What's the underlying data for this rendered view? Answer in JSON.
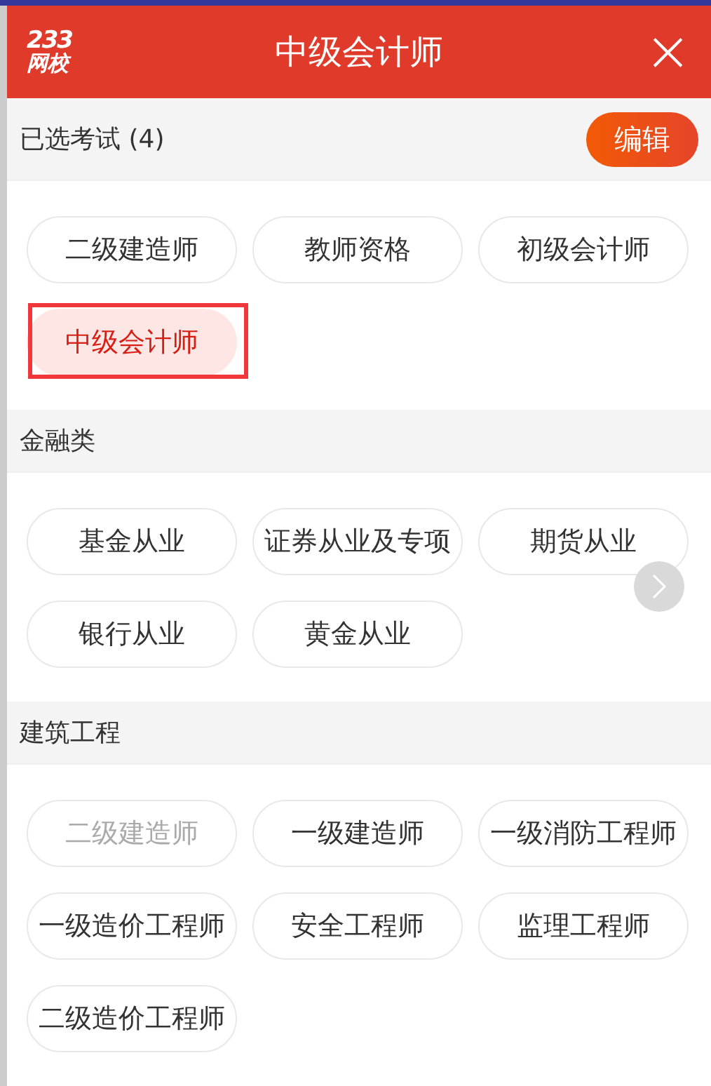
{
  "header": {
    "logo": {
      "number": "233",
      "name": "网校"
    },
    "title": "中级会计师",
    "close": "×"
  },
  "selected_exams": {
    "label": "已选考试 (4)",
    "edit_button": "编辑",
    "items": [
      {
        "label": "二级建造师",
        "selected": false,
        "outlined": false
      },
      {
        "label": "教师资格",
        "selected": false,
        "outlined": false
      },
      {
        "label": "初级会计师",
        "selected": false,
        "outlined": false
      },
      {
        "label": "中级会计师",
        "selected": true,
        "outlined": true
      }
    ]
  },
  "categories": [
    {
      "title": "金融类",
      "items": [
        {
          "label": "基金从业",
          "disabled": false
        },
        {
          "label": "证券从业及专项",
          "disabled": false
        },
        {
          "label": "期货从业",
          "disabled": false
        },
        {
          "label": "银行从业",
          "disabled": false
        },
        {
          "label": "黄金从业",
          "disabled": false
        }
      ]
    },
    {
      "title": "建筑工程",
      "items": [
        {
          "label": "二级建造师",
          "disabled": true
        },
        {
          "label": "一级建造师",
          "disabled": false
        },
        {
          "label": "一级消防工程师",
          "disabled": false
        },
        {
          "label": "一级造价工程师",
          "disabled": false
        },
        {
          "label": "安全工程师",
          "disabled": false
        },
        {
          "label": "监理工程师",
          "disabled": false
        },
        {
          "label": "二级造价工程师",
          "disabled": false
        }
      ]
    }
  ]
}
